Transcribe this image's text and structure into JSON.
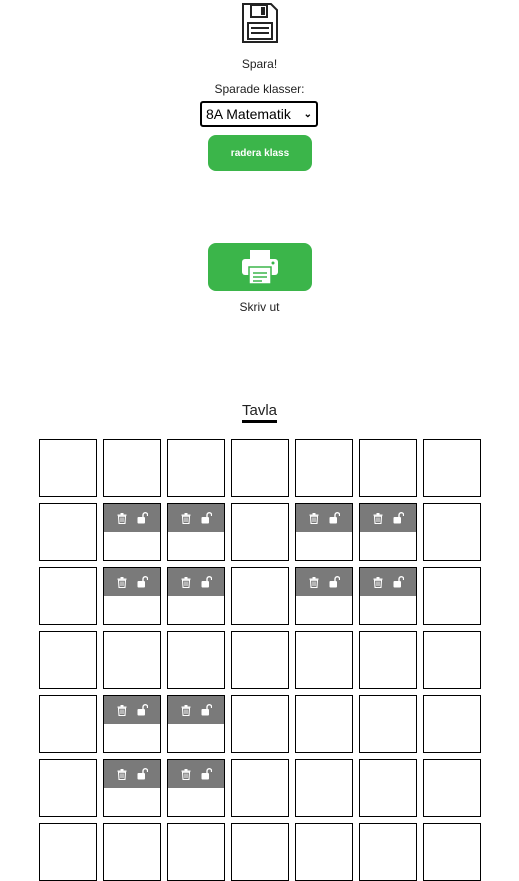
{
  "save": {
    "icon": "floppy-disk-icon",
    "label": "Spara!"
  },
  "saved_classes": {
    "label": "Sparade klasser:",
    "selected": "8A Matematik"
  },
  "delete_class": {
    "label": "radera klass"
  },
  "print": {
    "icon": "printer-icon",
    "label": "Skriv ut"
  },
  "board": {
    "title": "Tavla",
    "columns": 7,
    "visible_rows": 7,
    "occupied_cells": [
      {
        "row": 2,
        "col": 2
      },
      {
        "row": 2,
        "col": 3
      },
      {
        "row": 2,
        "col": 5
      },
      {
        "row": 2,
        "col": 6
      },
      {
        "row": 3,
        "col": 2
      },
      {
        "row": 3,
        "col": 3
      },
      {
        "row": 3,
        "col": 5
      },
      {
        "row": 3,
        "col": 6
      },
      {
        "row": 5,
        "col": 2
      },
      {
        "row": 5,
        "col": 3
      },
      {
        "row": 6,
        "col": 2
      },
      {
        "row": 6,
        "col": 3
      }
    ],
    "cell_icons": [
      "trash-icon",
      "unlock-icon"
    ]
  },
  "colors": {
    "accent": "#3bb54a",
    "seat_bar": "#7a7a7a",
    "border": "#000000"
  }
}
